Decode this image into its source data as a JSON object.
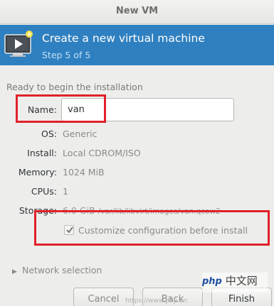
{
  "window": {
    "title": "New VM"
  },
  "banner": {
    "title": "Create a new virtual machine",
    "subtitle": "Step 5 of 5",
    "icon": "vm-monitor-icon",
    "color": "#2f80c0"
  },
  "summary": {
    "heading": "Ready to begin the installation",
    "name_label": "Name:",
    "name_value": "van",
    "os_label": "OS:",
    "os_value": "Generic",
    "install_label": "Install:",
    "install_value": "Local CDROM/ISO",
    "memory_label": "Memory:",
    "memory_value": "1024 MiB",
    "cpus_label": "CPUs:",
    "cpus_value": "1",
    "storage_label": "Storage:",
    "storage_size": "6.0 GiB",
    "storage_path": "/var/lib/libvirt/images/van.qcow2"
  },
  "customize": {
    "label": "Customize configuration before install",
    "checked": true
  },
  "network": {
    "label": "Network selection",
    "expanded": false
  },
  "buttons": {
    "cancel": "Cancel",
    "back": "Back",
    "finish": "Finish"
  },
  "annotation_color": "#e0212a",
  "watermark": {
    "text": "中文网",
    "url": "https://www.php.cn"
  }
}
